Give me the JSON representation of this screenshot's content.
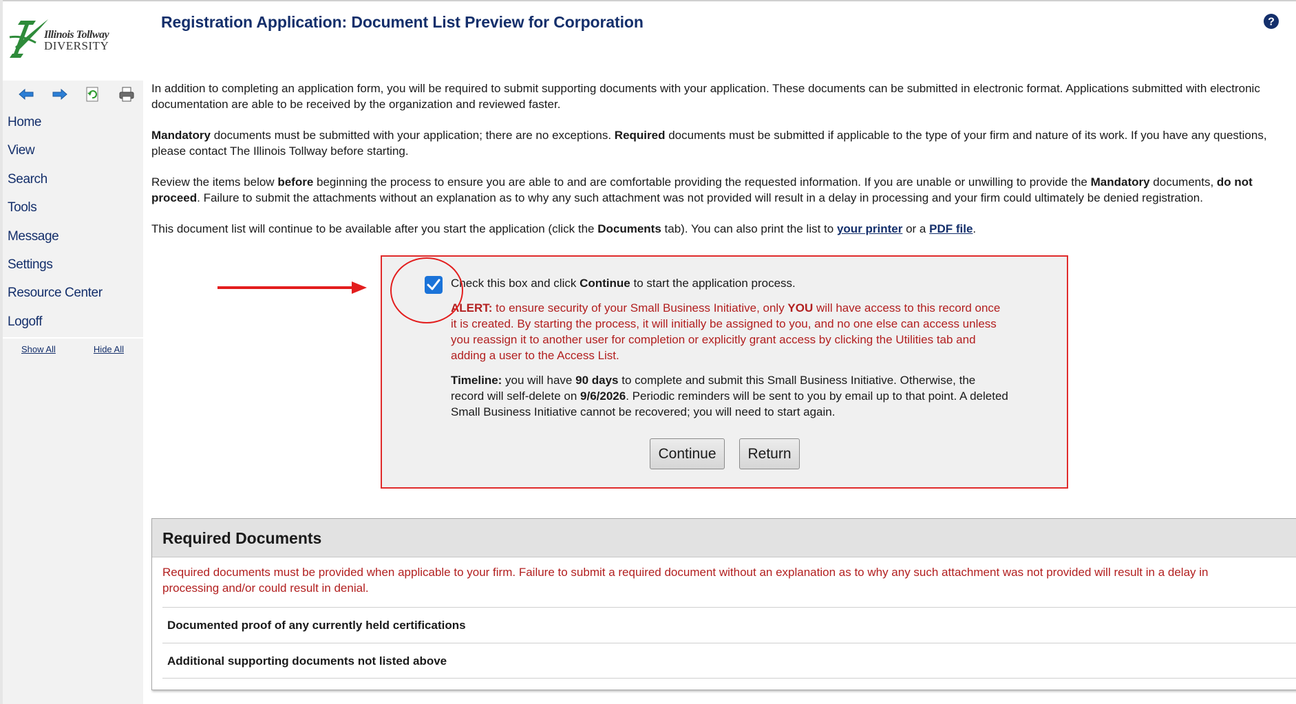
{
  "header": {
    "logo_script": "Illinois Tollway",
    "logo_sub": "DIVERSITY",
    "title": "Registration Application: Document List Preview for Corporation"
  },
  "sidebar": {
    "nav_icons": [
      "back-arrow-icon",
      "forward-arrow-icon",
      "refresh-icon",
      "print-icon"
    ],
    "items": [
      {
        "label": "Home"
      },
      {
        "label": "View"
      },
      {
        "label": "Search"
      },
      {
        "label": "Tools"
      },
      {
        "label": "Message"
      },
      {
        "label": "Settings"
      },
      {
        "label": "Resource Center"
      },
      {
        "label": "Logoff"
      }
    ],
    "show_all": "Show All",
    "hide_all": "Hide All"
  },
  "intro": {
    "p1": "In addition to completing an application form, you will be required to submit supporting documents with your application. These documents can be submitted in electronic format. Applications submitted with electronic documentation are able to be received by the organization and reviewed faster.",
    "p2_b1": "Mandatory",
    "p2_t1": " documents must be submitted with your application; there are no exceptions. ",
    "p2_b2": "Required",
    "p2_t2": " documents must be submitted if applicable to the type of your firm and nature of its work. If you have any questions, please contact The Illinois Tollway before starting.",
    "p3_t1": "Review the items below ",
    "p3_b1": "before",
    "p3_t2": " beginning the process to ensure you are able to and are comfortable providing the requested information. If you are unable or unwilling to provide the ",
    "p3_b2": "Mandatory",
    "p3_t3": " documents, ",
    "p3_b3": "do not proceed",
    "p3_t4": ". Failure to submit the attachments without an explanation as to why any such attachment was not provided will result in a delay in processing and your firm could ultimately be denied registration.",
    "p4_t1": "This document list will continue to be available after you start the application (click the ",
    "p4_b1": "Documents",
    "p4_t2": " tab). You can also print the list to ",
    "p4_link1": "your printer",
    "p4_t3": " or a ",
    "p4_link2": "PDF file",
    "p4_t4": "."
  },
  "confirm": {
    "checked": true,
    "label_t1": "Check this box and click ",
    "label_b1": "Continue",
    "label_t2": " to start the application process.",
    "alert_b1": "ALERT:",
    "alert_t1": " to ensure security of your Small Business Initiative, only ",
    "alert_b2": "YOU",
    "alert_t2": " will have access to this record once it is created. By starting the process, it will initially be assigned to you, and no one else can access unless you reassign it to another user for completion or explicitly grant access by clicking the Utilities tab and adding a user to the Access List.",
    "timeline_b1": "Timeline:",
    "timeline_t1": " you will have ",
    "timeline_b2": "90 days",
    "timeline_t2": " to complete and submit this Small Business Initiative. Otherwise, the record will self-delete on ",
    "timeline_b3": "9/6/2026",
    "timeline_t3": ". Periodic reminders will be sent to you by email up to that point. A deleted Small Business Initiative cannot be recovered; you will need to start again.",
    "continue_label": "Continue",
    "return_label": "Return"
  },
  "required": {
    "title": "Required Documents",
    "note": "Required documents must be provided when applicable to your firm. Failure to submit a required document without an explanation as to why any such attachment was not provided will result in a delay in processing and/or could result in denial.",
    "items": [
      {
        "label": "Documented proof of any currently held certifications"
      },
      {
        "label": "Additional supporting documents not listed above"
      }
    ]
  },
  "colors": {
    "brand_navy": "#142f6b",
    "alert_red": "#b21f1f",
    "checkbox_blue": "#1a73d9",
    "annotation_red": "#e31e1e",
    "logo_green": "#2e8b3a"
  }
}
